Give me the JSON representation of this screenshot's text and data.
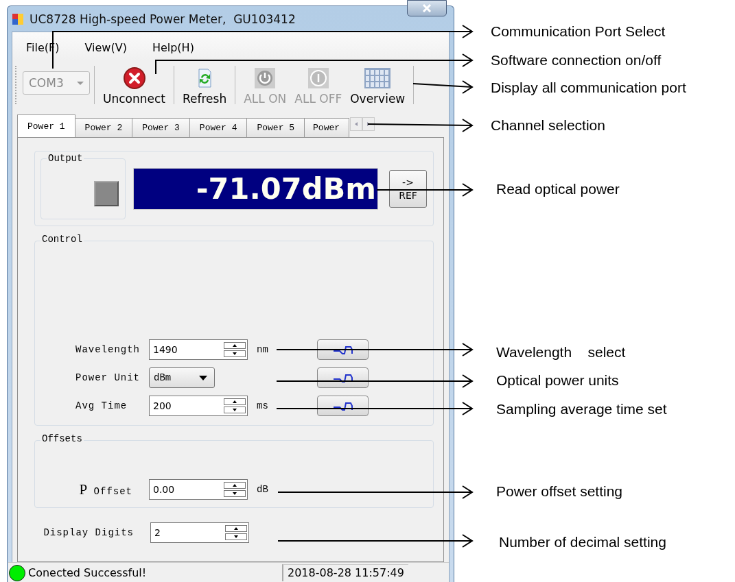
{
  "window": {
    "title": "UC8728 High-speed Power Meter,  GU103412"
  },
  "menu": [
    {
      "label": "File(F)"
    },
    {
      "label": "View(V)"
    },
    {
      "label": "Help(H)"
    }
  ],
  "toolbar": {
    "port": {
      "value": "COM3",
      "disabled": true
    },
    "buttons": [
      {
        "label": "Unconnect",
        "kind": "disconnect",
        "disabled": false
      },
      {
        "label": "Refresh",
        "kind": "refresh",
        "disabled": false
      },
      {
        "label": "ALL ON",
        "kind": "power",
        "disabled": true
      },
      {
        "label": "ALL OFF",
        "kind": "off",
        "disabled": true
      },
      {
        "label": "Overview",
        "kind": "grid",
        "disabled": false
      }
    ]
  },
  "tabs": [
    {
      "label": "Power 1",
      "selected": true
    },
    {
      "label": "Power 2",
      "selected": false
    },
    {
      "label": "Power 3",
      "selected": false
    },
    {
      "label": "Power 4",
      "selected": false
    },
    {
      "label": "Power 5",
      "selected": false
    },
    {
      "label": "Power",
      "selected": false
    }
  ],
  "output": {
    "title": "Output",
    "led_on": false,
    "reading": "-71.07dBm",
    "ref_button": [
      "->",
      "REF"
    ]
  },
  "control": {
    "title": "Control",
    "rows": [
      {
        "kind": "spin",
        "label": "Wavelength",
        "value": "1490",
        "unit": "nm"
      },
      {
        "kind": "combo",
        "label": "Power Unit",
        "value": "dBm"
      },
      {
        "kind": "spin",
        "label": "Avg Time",
        "value": "200",
        "unit": "ms"
      }
    ]
  },
  "offsets": {
    "title": "Offsets",
    "rows": [
      {
        "prefix": "P",
        "label": "Offset",
        "value": "0.00",
        "unit": "dB"
      }
    ]
  },
  "display_digits": {
    "label": "Display Digits",
    "value": "2"
  },
  "status_bar": {
    "connected": true,
    "message": "Conected Successful!",
    "time": "2018-08-28 11:57:49"
  },
  "annotations": [
    {
      "text": "Communication Port Select"
    },
    {
      "text": "Software connection on/off"
    },
    {
      "text": "Display all communication port"
    },
    {
      "text": "Channel selection"
    },
    {
      "text": "Read optical power"
    },
    {
      "text": "Wavelength    select"
    },
    {
      "text": "Optical power units"
    },
    {
      "text": "Sampling average time set"
    },
    {
      "text": "Power offset setting"
    },
    {
      "text": "Number of decimal setting"
    }
  ]
}
